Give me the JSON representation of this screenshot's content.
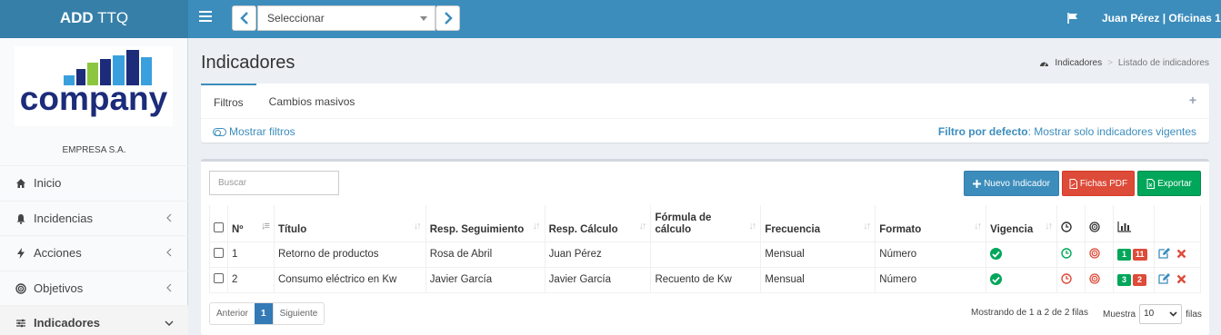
{
  "header": {
    "brand_bold": "ADD",
    "brand_rest": " TTQ",
    "selector_value": "Seleccionar",
    "user": "Juan Pérez | Oficinas 1"
  },
  "sidebar": {
    "logo_text": "company",
    "company_name": "EMPRESA S.A.",
    "items": [
      {
        "label": "Inicio",
        "icon": "home-icon"
      },
      {
        "label": "Incidencias",
        "icon": "bell-icon"
      },
      {
        "label": "Acciones",
        "icon": "bolt-icon"
      },
      {
        "label": "Objetivos",
        "icon": "target-icon"
      },
      {
        "label": "Indicadores",
        "icon": "sliders-icon"
      }
    ]
  },
  "page": {
    "title": "Indicadores",
    "breadcrumb": [
      "Indicadores",
      "Listado de indicadores"
    ]
  },
  "filters": {
    "tabs": [
      "Filtros",
      "Cambios masivos"
    ],
    "show_filters": "Mostrar filtros",
    "default_filter_label": "Filtro por defecto",
    "default_filter_value": ": Mostrar solo indicadores vigentes"
  },
  "toolbar": {
    "search_placeholder": "Buscar",
    "new_label": "Nuevo Indicador",
    "pdf_label": "Fichas PDF",
    "export_label": "Exportar"
  },
  "table": {
    "headers": [
      "Nº",
      "Título",
      "Resp. Seguimiento",
      "Resp. Cálculo",
      "Fórmula de cálculo",
      "Frecuencia",
      "Formato",
      "Vigencia"
    ],
    "rows": [
      {
        "n": "1",
        "titulo": "Retorno de productos",
        "resp_seg": "Rosa de Abril",
        "resp_calc": "Juan Pérez",
        "formula": "",
        "frecuencia": "Mensual",
        "formato": "Número",
        "badge_g": "1",
        "badge_r": "11"
      },
      {
        "n": "2",
        "titulo": "Consumo eléctrico en Kw",
        "resp_seg": "Javier García",
        "resp_calc": "Javier García",
        "formula": "Recuento de Kw",
        "frecuencia": "Mensual",
        "formato": "Número",
        "badge_g": "3",
        "badge_r": "2"
      }
    ]
  },
  "pagination": {
    "prev": "Anterior",
    "current": "1",
    "next": "Siguiente",
    "showing": "Mostrando de 1 a 2 de 2 filas",
    "show_label": "Muestra",
    "page_size": "10",
    "rows_label": "filas"
  }
}
